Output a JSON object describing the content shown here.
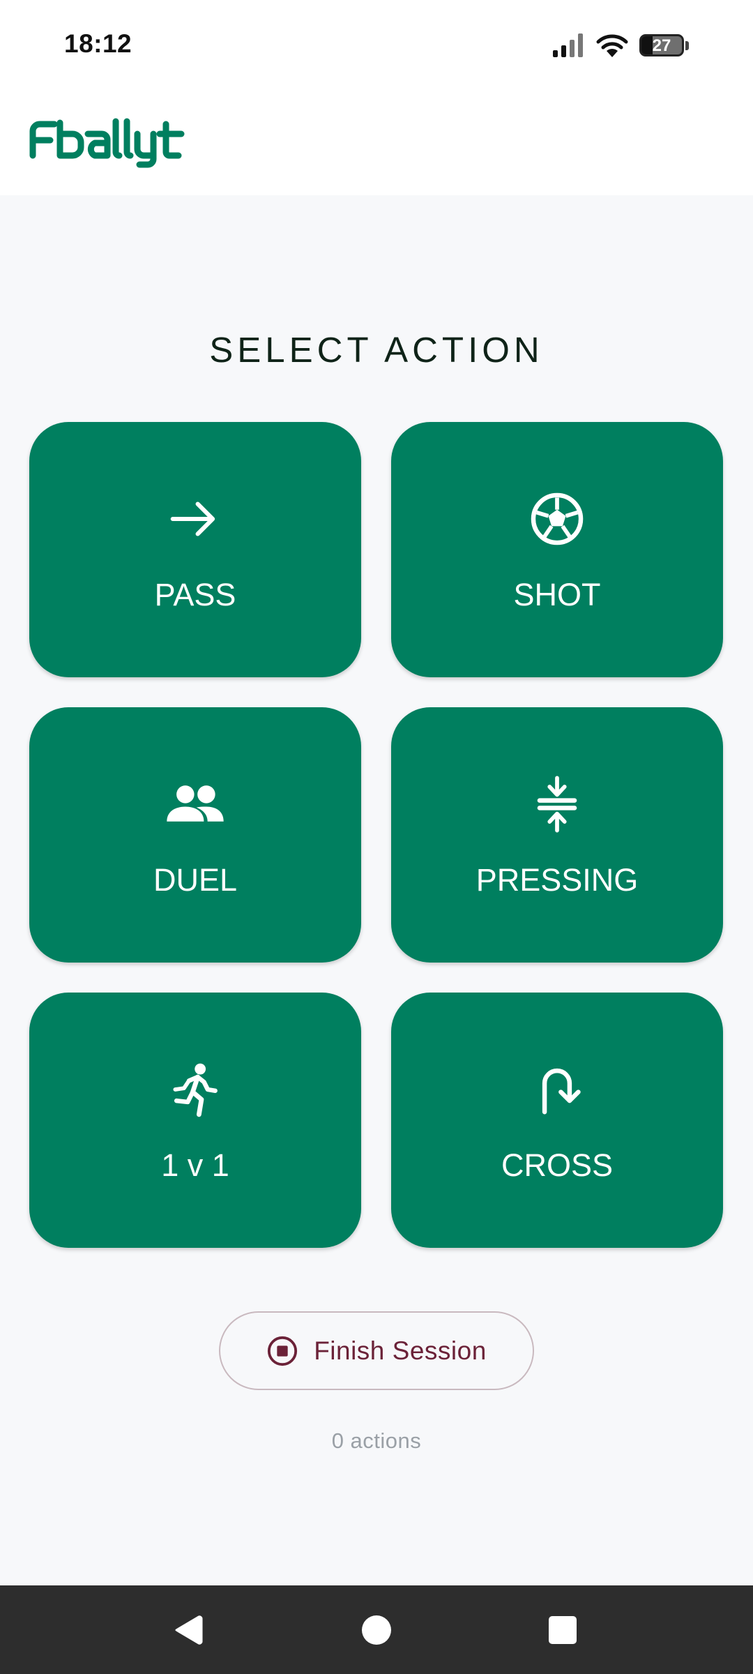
{
  "status_bar": {
    "time": "18:12",
    "battery_level": "27",
    "battery_fraction": 0.27,
    "icons": [
      "signal-icon",
      "wifi-icon",
      "battery-icon"
    ]
  },
  "app": {
    "logo_text": "Fballyt",
    "brand_color": "#007f5f"
  },
  "main": {
    "title": "SELECT ACTION",
    "actions": [
      {
        "label": "PASS",
        "icon": "arrow-right-icon"
      },
      {
        "label": "SHOT",
        "icon": "soccer-ball-icon"
      },
      {
        "label": "DUEL",
        "icon": "people-icon"
      },
      {
        "label": "PRESSING",
        "icon": "compress-icon"
      },
      {
        "label": "1 v 1",
        "icon": "running-icon"
      },
      {
        "label": "CROSS",
        "icon": "u-turn-arrow-icon"
      }
    ],
    "finish_button": {
      "label": "Finish Session",
      "icon": "stop-circle-icon",
      "color": "#6b2238"
    },
    "actions_count": "0 actions"
  },
  "nav_bar": {
    "buttons": [
      "back-icon",
      "home-icon",
      "recents-icon"
    ]
  }
}
